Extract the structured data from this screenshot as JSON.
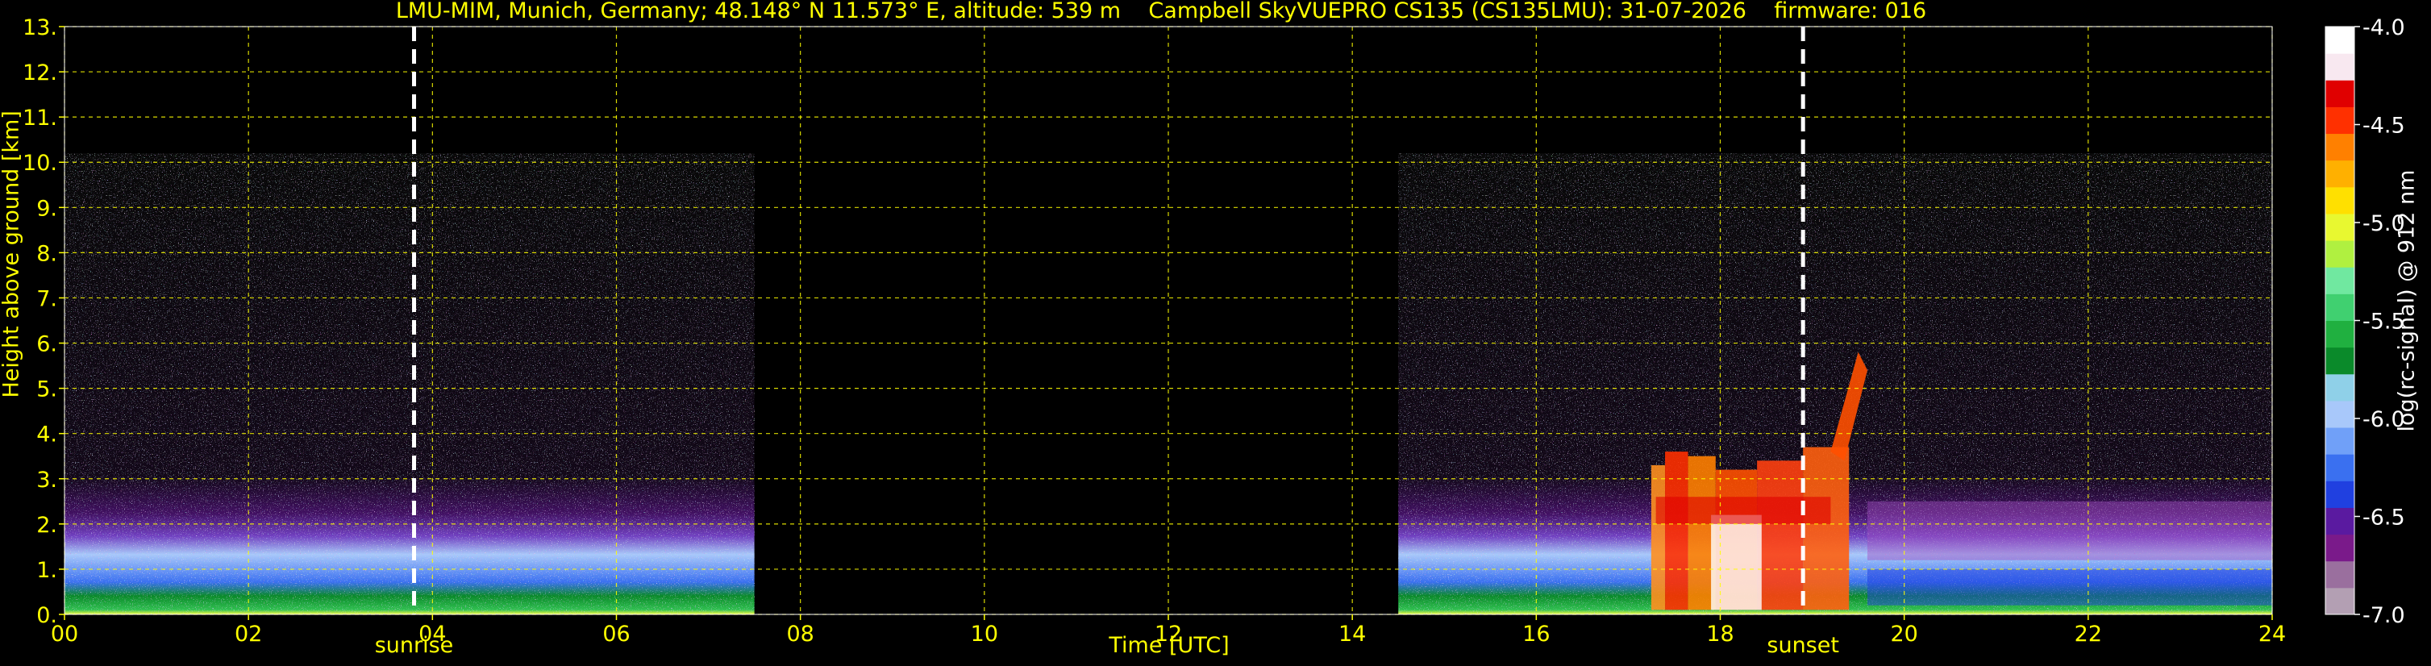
{
  "title": "LMU-MIM, Munich, Germany; 48.148° N 11.573° E, altitude: 539 m    Campbell SkyVUEPRO CS135 (CS135LMU): 31-07-2026    firmware: 016",
  "chart_data": {
    "type": "heatmap",
    "title": "LMU-MIM, Munich, Germany; 48.148° N 11.573° E, altitude: 539 m    Campbell SkyVUEPRO CS135 (CS135LMU): 31-07-2026    firmware: 016",
    "xlabel": "Time [UTC]",
    "ylabel": "Height above ground [km]",
    "xlim": [
      0,
      24
    ],
    "ylim": [
      0,
      13
    ],
    "xticks": [
      "00",
      "02",
      "04",
      "06",
      "08",
      "10",
      "12",
      "14",
      "16",
      "18",
      "20",
      "22",
      "24"
    ],
    "yticks": [
      "0.",
      "1.",
      "2.",
      "3.",
      "4.",
      "5.",
      "6.",
      "7.",
      "8.",
      "9.",
      "10.",
      "11.",
      "12.",
      "13."
    ],
    "grid": true,
    "data_segments": [
      {
        "x_start": 0.0,
        "x_end": 7.5,
        "max_height_km": 10.2
      },
      {
        "x_start": 14.5,
        "x_end": 24.0,
        "max_height_km": 10.2
      }
    ],
    "events": [
      {
        "label": "sunrise",
        "x": 3.8
      },
      {
        "label": "sunset",
        "x": 18.9
      }
    ],
    "colorbar": {
      "label": "log(rc-signal) @ 912 nm",
      "min": -7.0,
      "max": -4.0,
      "ticks": [
        "-4.0",
        "-4.5",
        "-5.0",
        "-5.5",
        "-6.0",
        "-6.5",
        "-7.0"
      ],
      "colors": [
        "#b39fb3",
        "#9a6f9e",
        "#7a1a8a",
        "#5a1aa0",
        "#2040e0",
        "#3a70f0",
        "#70a0f8",
        "#a8c8fa",
        "#8fd0e8",
        "#0a8a2a",
        "#20b040",
        "#40d070",
        "#70e8a0",
        "#b0f040",
        "#e8f830",
        "#ffe000",
        "#ffb000",
        "#ff8000",
        "#ff3000",
        "#e00000",
        "#f8e8f0",
        "#ffffff"
      ]
    }
  }
}
